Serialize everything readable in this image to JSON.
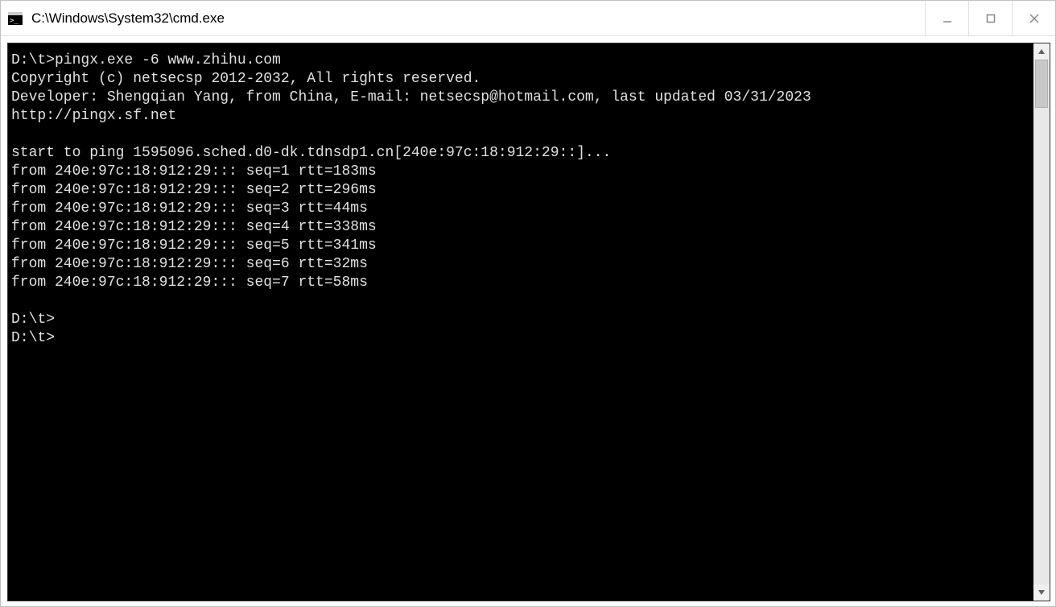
{
  "window": {
    "title": "C:\\Windows\\System32\\cmd.exe"
  },
  "terminal": {
    "prompt": "D:\\t>",
    "command": "pingx.exe -6 www.zhihu.com",
    "copyright": "Copyright (c) netsecsp 2012-2032, All rights reserved.",
    "developer": "Developer: Shengqian Yang, from China, E-mail: netsecsp@hotmail.com, last updated 03/31/2023",
    "url": "http://pingx.sf.net",
    "start_line": "start to ping 1595096.sched.d0-dk.tdnsdp1.cn[240e:97c:18:912:29::]...",
    "replies": [
      "from 240e:97c:18:912:29::: seq=1 rtt=183ms",
      "from 240e:97c:18:912:29::: seq=2 rtt=296ms",
      "from 240e:97c:18:912:29::: seq=3 rtt=44ms",
      "from 240e:97c:18:912:29::: seq=4 rtt=338ms",
      "from 240e:97c:18:912:29::: seq=5 rtt=341ms",
      "from 240e:97c:18:912:29::: seq=6 rtt=32ms",
      "from 240e:97c:18:912:29::: seq=7 rtt=58ms"
    ],
    "trailing_prompts": [
      "D:\\t>",
      "D:\\t>"
    ]
  }
}
